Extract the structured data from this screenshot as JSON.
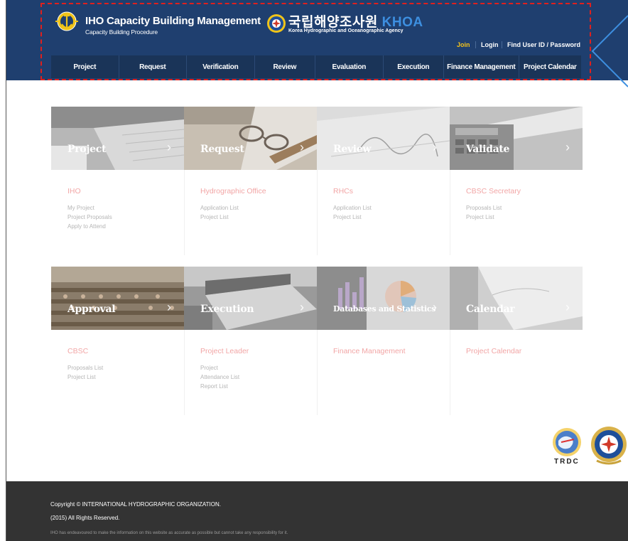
{
  "header": {
    "title": "IHO Capacity Building Management",
    "subtitle": "Capacity Building Procedure",
    "khoa_korean": "국립해양조사원",
    "khoa_abbr": "KHOA",
    "khoa_english": "Korea Hydrographic and Oceanographic Agency",
    "util": {
      "join": "Join",
      "login": "Login",
      "find": "Find User ID / Password"
    },
    "colors": {
      "bar": "#1f3f6f",
      "nav": "#1a3458",
      "join": "#f3c21b"
    }
  },
  "nav": [
    "Project",
    "Request",
    "Verification",
    "Review",
    "Evaluation",
    "Execution",
    "Finance Management",
    "Project Calendar"
  ],
  "tiles": [
    {
      "title": "Project",
      "role": "IHO",
      "links": [
        "My Project",
        "Project Proposals",
        "Apply to Attend"
      ],
      "icon": "keyboard-photo"
    },
    {
      "title": "Request",
      "role": "Hydrographic Office",
      "links": [
        "Application List",
        "Project List"
      ],
      "icon": "glasses-photo"
    },
    {
      "title": "Review",
      "role": "RHCs",
      "links": [
        "Application List",
        "Project List"
      ],
      "icon": "signature-photo"
    },
    {
      "title": "Validate",
      "role": "CBSC Secretary",
      "links": [
        "Proposals List",
        "Project List"
      ],
      "icon": "calculator-photo"
    },
    {
      "title": "Approval",
      "role": "CBSC",
      "links": [
        "Proposals List",
        "Project List"
      ],
      "icon": "assembly-photo"
    },
    {
      "title": "Execution",
      "role": "Project Leader",
      "links": [
        "Project",
        "Attendance List",
        "Report List"
      ],
      "icon": "laptop-photo"
    },
    {
      "title": "Databases and Statistics",
      "role": "Finance Management",
      "links": [],
      "icon": "chart-photo"
    },
    {
      "title": "Calendar",
      "role": "Project Calendar",
      "links": [],
      "icon": "notebook-photo"
    }
  ],
  "badges": {
    "trdc": "TRDC"
  },
  "footer": {
    "copyright": "Copyright © INTERNATIONAL HYDROGRAPHIC ORGANIZATION.",
    "rights": "(2015) All Rights Reserved.",
    "disclaimer": "IHO has endeavoured to make the information on this website as accurate as possible but cannot take any responsibility for it."
  }
}
